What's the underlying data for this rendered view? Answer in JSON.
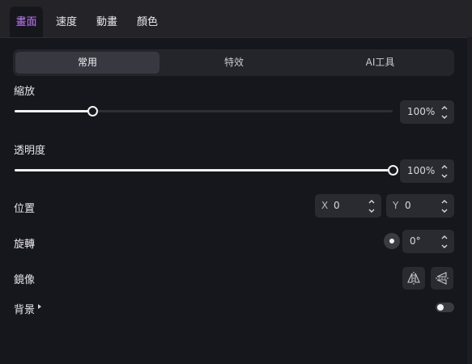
{
  "tabs": [
    {
      "label": "畫面",
      "active": true
    },
    {
      "label": "速度",
      "active": false
    },
    {
      "label": "動畫",
      "active": false
    },
    {
      "label": "顏色",
      "active": false
    }
  ],
  "segments": [
    {
      "label": "常用",
      "active": true
    },
    {
      "label": "特效",
      "active": false
    },
    {
      "label": "AI工具",
      "active": false
    }
  ],
  "scale": {
    "label": "縮放",
    "value_text": "100%",
    "level": 0.206
  },
  "opacity": {
    "label": "透明度",
    "value_text": "100%",
    "level": 1.0
  },
  "position": {
    "label": "位置",
    "x_label": "X",
    "x_value": "0",
    "y_label": "Y",
    "y_value": "0"
  },
  "rotation": {
    "label": "旋轉",
    "value_text": "0°"
  },
  "mirror": {
    "label": "鏡像",
    "icons": [
      "flip-horizontal-icon",
      "flip-vertical-icon"
    ]
  },
  "background": {
    "label": "背景",
    "enabled": false
  },
  "colors": {
    "accent": "#c07cf3",
    "panel": "#16161d",
    "control": "#2a2a31"
  }
}
